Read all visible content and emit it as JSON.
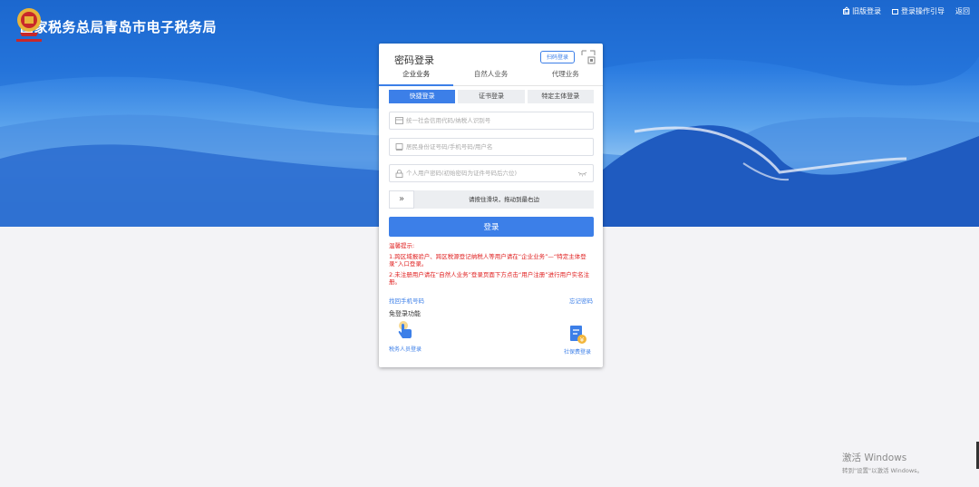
{
  "header": {
    "site_title": "国家税务总局青岛市电子税务局",
    "nav": [
      {
        "label": "旧版登录",
        "icon": "old-version-icon"
      },
      {
        "label": "登录操作引导",
        "icon": "guide-book-icon"
      },
      {
        "label": "返回",
        "icon": "home-icon"
      }
    ]
  },
  "login": {
    "title": "密码登录",
    "scan_label": "扫码登录",
    "tabs": [
      "企业业务",
      "自然人业务",
      "代理业务"
    ],
    "active_tab": "企业业务",
    "subtabs": [
      "快捷登录",
      "证书登录",
      "特定主体登录"
    ],
    "active_subtab": "快捷登录",
    "fields": {
      "credit_code_placeholder": "统一社会信用代码/纳税人识别号",
      "id_placeholder": "居民身份证号码/手机号码/用户名",
      "password_placeholder": "个人用户密码(初始密码为证件号码后六位)"
    },
    "slider_text": "请按住滑块，拖动到最右边",
    "login_button": "登录",
    "tips_title": "温馨提示:",
    "tip1": "1.跨区域报验户、跨区税源登记纳税人等用户请在“企业业务”—“特定主体登录”入口登录。",
    "tip2": "2.未注册用户请在“自然人业务”登录页面下方点击“用户注册”进行用户实名注册。",
    "retrieve_phone": "找回手机号码",
    "forgot_password": "忘记密码",
    "no_login_title": "免登录功能",
    "quick_items": [
      {
        "label": "税务人员登录",
        "icon": "hand-pointer-icon"
      },
      {
        "label": "社保费登录",
        "icon": "social-security-icon"
      }
    ]
  },
  "watermark": {
    "line1": "激活 Windows",
    "line2": "转到\"设置\"以激活 Windows。"
  },
  "colors": {
    "accent": "#3c7fe8",
    "tip_red": "#e02020"
  }
}
